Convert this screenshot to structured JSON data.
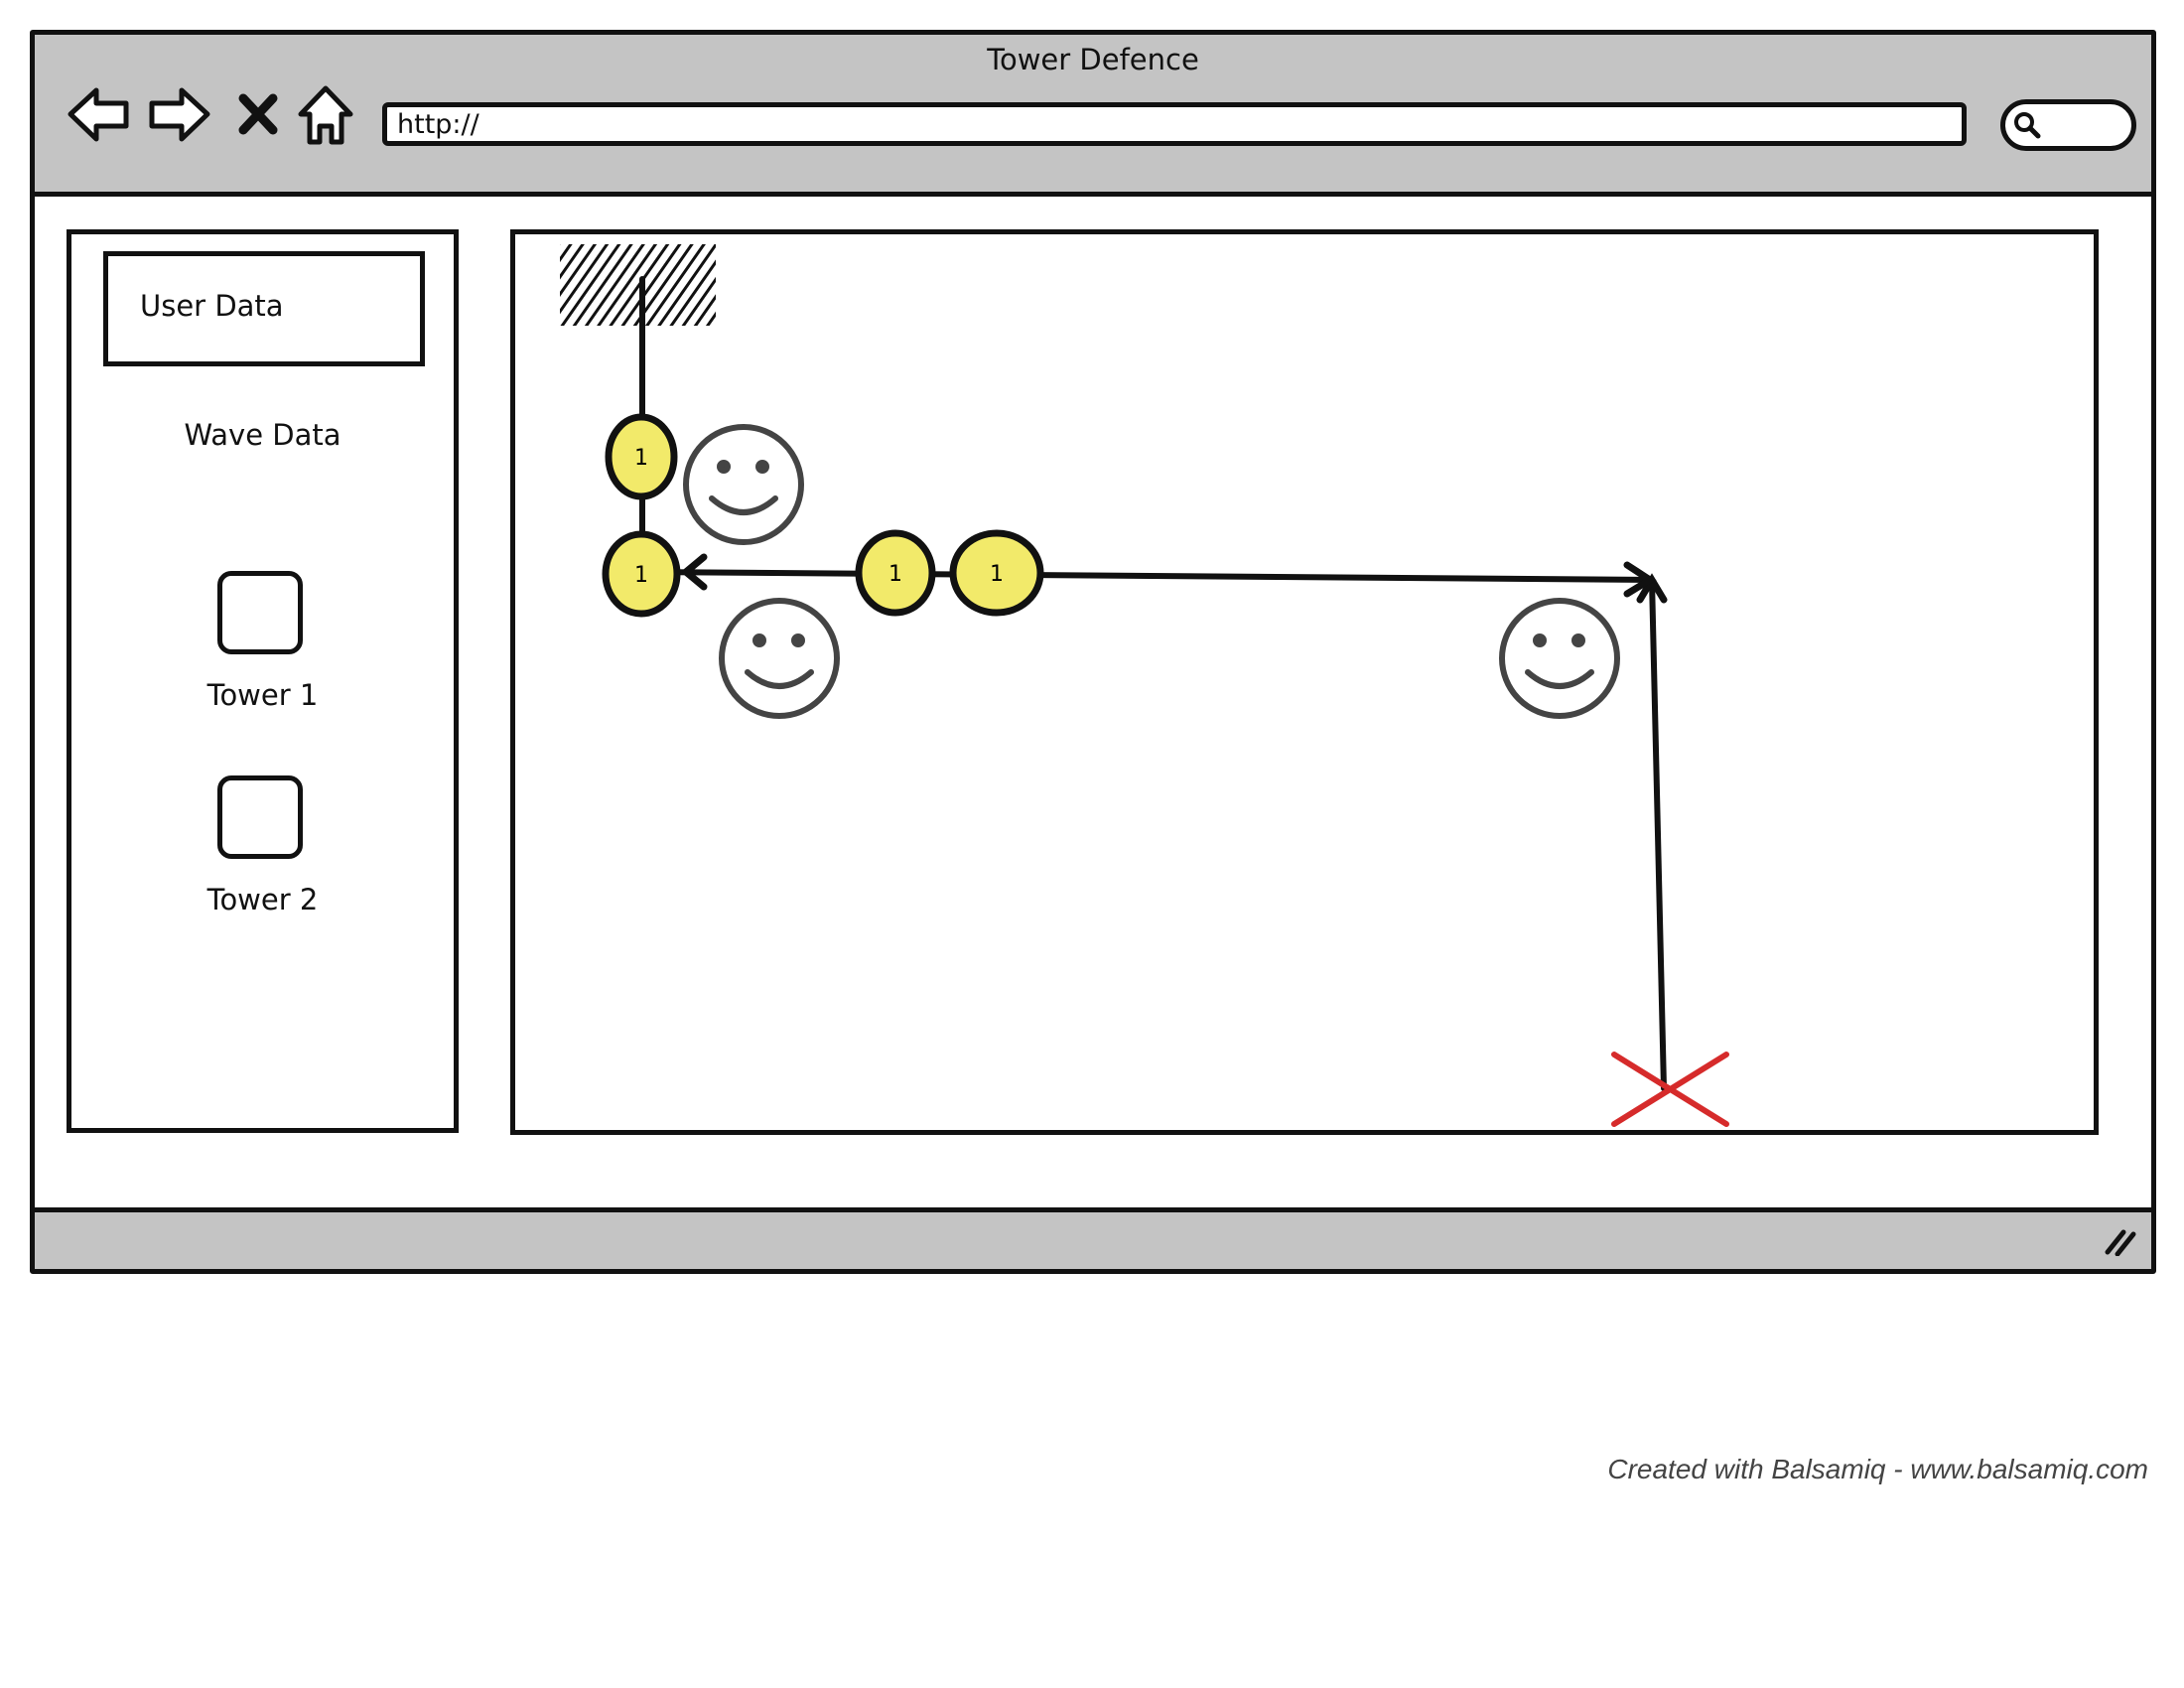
{
  "window": {
    "title": "Tower Defence"
  },
  "toolbar": {
    "url": "http://",
    "back_icon": "arrow-left-icon",
    "forward_icon": "arrow-right-icon",
    "stop_icon": "close-icon",
    "home_icon": "home-icon",
    "search_icon": "search-icon"
  },
  "sidebar": {
    "user_data_label": "User Data",
    "wave_data_label": "Wave Data",
    "towers": [
      {
        "label": "Tower 1"
      },
      {
        "label": "Tower 2"
      }
    ]
  },
  "game": {
    "enemies": [
      {
        "label": "1"
      },
      {
        "label": "1"
      },
      {
        "label": "1"
      },
      {
        "label": "1"
      }
    ],
    "colors": {
      "enemy_fill": "#f2ea6a",
      "goal_marker": "#d62b2b",
      "ink": "#111111",
      "tower_face": "#444444"
    }
  },
  "footer": {
    "credit": "Created with Balsamiq - www.balsamiq.com"
  }
}
